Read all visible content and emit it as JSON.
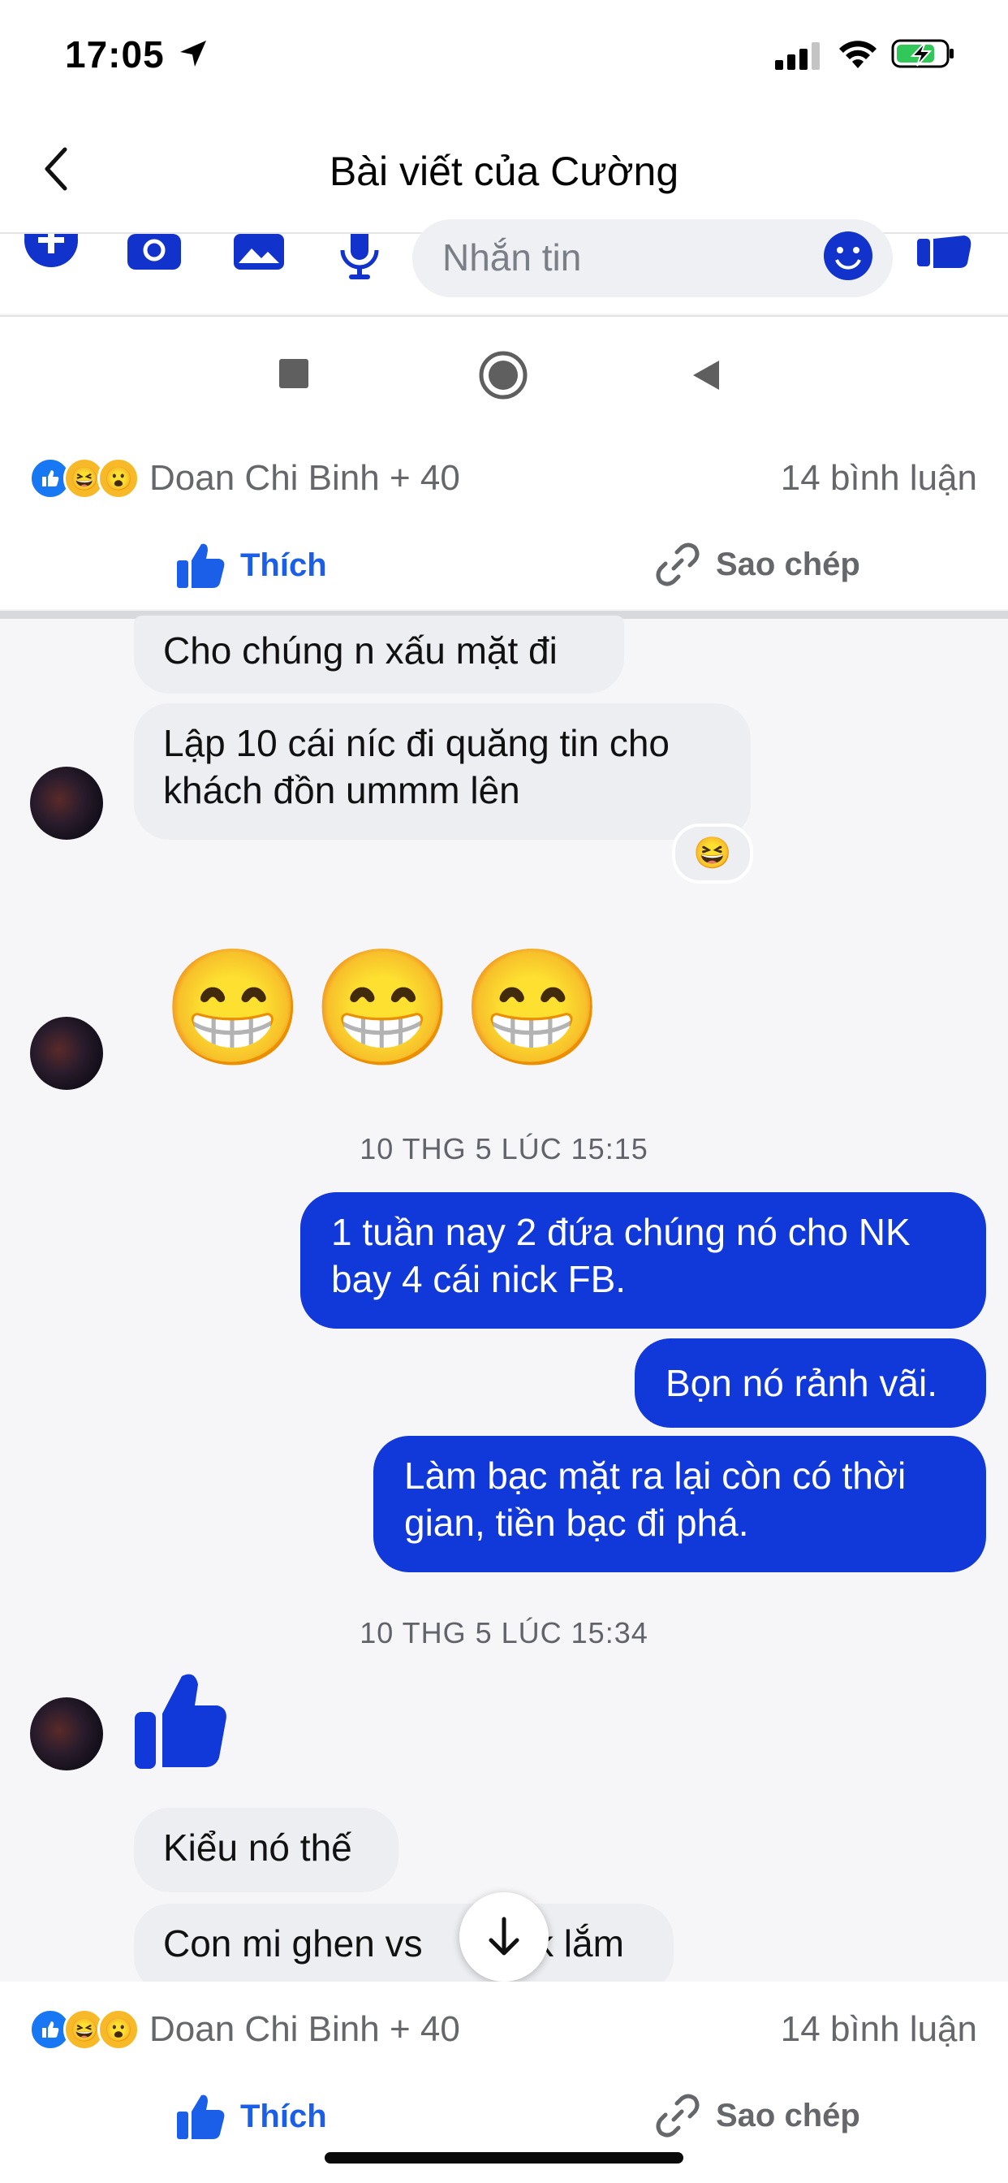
{
  "status_bar": {
    "time": "17:05"
  },
  "header": {
    "title": "Bài viết của Cường"
  },
  "composer": {
    "placeholder": "Nhắn tin"
  },
  "post_reactions": {
    "reactors": "Doan Chi Binh + 40",
    "comments": "14 bình luận",
    "like_label": "Thích",
    "copy_label": "Sao chép"
  },
  "chat": {
    "messages": [
      {
        "side": "in",
        "text": "Cho chúng n xấu mặt đi"
      },
      {
        "side": "in",
        "text": "Lập 10 cái níc đi quăng tin cho khách đồn ummm lên",
        "reaction": "😆"
      },
      {
        "side": "in",
        "type": "emoji",
        "text": "😁😁😁"
      },
      {
        "type": "timestamp",
        "text": "10 THG 5 LÚC 15:15"
      },
      {
        "side": "out",
        "text": "1 tuần nay 2 đứa chúng nó cho NK bay 4 cái nick FB."
      },
      {
        "side": "out",
        "text": "Bọn nó rảnh vãi."
      },
      {
        "side": "out",
        "text": "Làm bạc mặt ra lại còn có thời gian, tiền bạc đi phá."
      },
      {
        "type": "timestamp",
        "text": "10 THG 5 LÚC 15:34"
      },
      {
        "side": "in",
        "type": "like-sticker"
      },
      {
        "side": "in",
        "text": "Kiểu nó thế"
      },
      {
        "side": "in",
        "text": "Con mi ghen vs",
        "text_tail": "k lắm"
      }
    ]
  },
  "colors": {
    "accent": "#1b5ee8",
    "outgoing_bubble": "#1138d8",
    "incoming_bubble": "#eceef1"
  }
}
